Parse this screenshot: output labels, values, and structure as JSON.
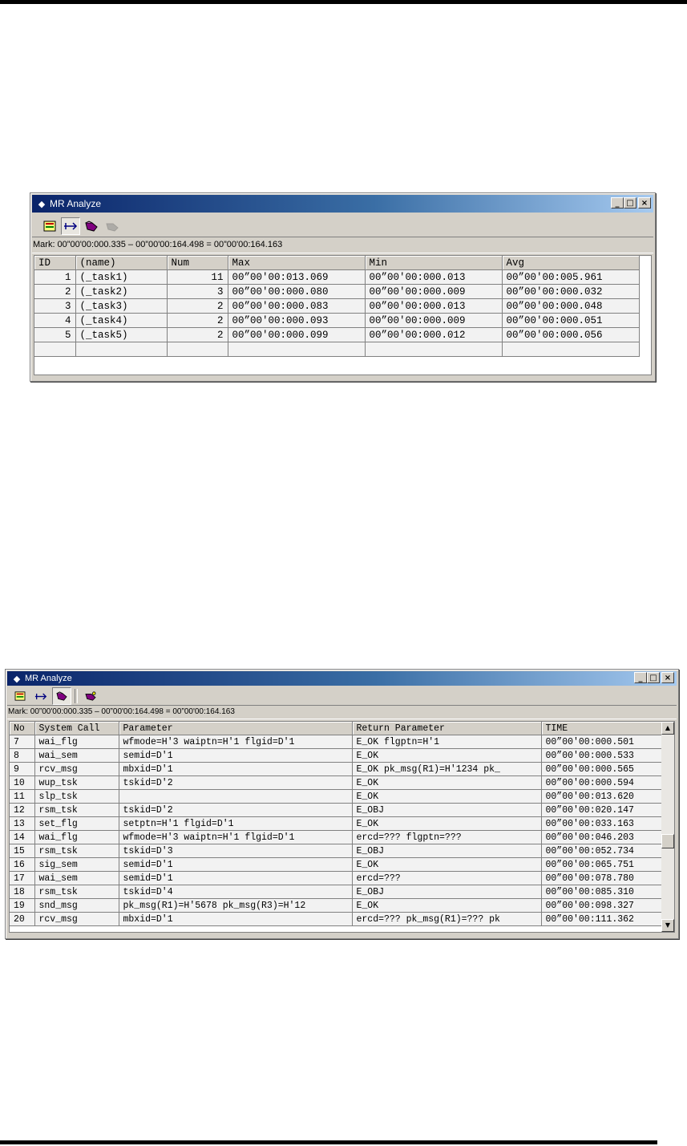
{
  "window1": {
    "title": "MR Analyze",
    "mark": "Mark: 00”00'00:000.335 – 00”00'00:164.498 = 00”00'00:164.163",
    "columns": [
      "ID",
      "(name)",
      "Num",
      "Max",
      "Min",
      "Avg"
    ],
    "rows": [
      {
        "id": "1",
        "name": "(_task1)",
        "num": "11",
        "max": "00”00'00:013.069",
        "min": "00”00'00:000.013",
        "avg": "00”00'00:005.961"
      },
      {
        "id": "2",
        "name": "(_task2)",
        "num": "3",
        "max": "00”00'00:000.080",
        "min": "00”00'00:000.009",
        "avg": "00”00'00:000.032"
      },
      {
        "id": "3",
        "name": "(_task3)",
        "num": "2",
        "max": "00”00'00:000.083",
        "min": "00”00'00:000.013",
        "avg": "00”00'00:000.048"
      },
      {
        "id": "4",
        "name": "(_task4)",
        "num": "2",
        "max": "00”00'00:000.093",
        "min": "00”00'00:000.009",
        "avg": "00”00'00:000.051"
      },
      {
        "id": "5",
        "name": "(_task5)",
        "num": "2",
        "max": "00”00'00:000.099",
        "min": "00”00'00:000.012",
        "avg": "00”00'00:000.056"
      }
    ]
  },
  "window2": {
    "title": "MR Analyze",
    "mark": "Mark: 00”00'00:000.335 – 00”00'00:164.498 = 00”00'00:164.163",
    "columns": [
      "No",
      "System Call",
      "Parameter",
      "Return Parameter",
      "TIME"
    ],
    "rows": [
      {
        "no": "7",
        "call": "wai_flg",
        "param": "wfmode=H'3   waiptn=H'1   flgid=D'1",
        "ret": "E_OK   flgptn=H'1",
        "time": "00”00'00:000.501"
      },
      {
        "no": "8",
        "call": "wai_sem",
        "param": "semid=D'1",
        "ret": "E_OK",
        "time": "00”00'00:000.533"
      },
      {
        "no": "9",
        "call": "rcv_msg",
        "param": "mbxid=D'1",
        "ret": "E_OK   pk_msg(R1)=H'1234   pk_",
        "time": "00”00'00:000.565"
      },
      {
        "no": "10",
        "call": "wup_tsk",
        "param": "tskid=D'2",
        "ret": "E_OK",
        "time": "00”00'00:000.594"
      },
      {
        "no": "11",
        "call": "slp_tsk",
        "param": "",
        "ret": "E_OK",
        "time": "00”00'00:013.620"
      },
      {
        "no": "12",
        "call": "rsm_tsk",
        "param": "tskid=D'2",
        "ret": "E_OBJ",
        "time": "00”00'00:020.147"
      },
      {
        "no": "13",
        "call": "set_flg",
        "param": "setptn=H'1   flgid=D'1",
        "ret": "E_OK",
        "time": "00”00'00:033.163"
      },
      {
        "no": "14",
        "call": "wai_flg",
        "param": "wfmode=H'3   waiptn=H'1   flgid=D'1",
        "ret": "ercd=???   flgptn=???",
        "time": "00”00'00:046.203"
      },
      {
        "no": "15",
        "call": "rsm_tsk",
        "param": "tskid=D'3",
        "ret": "E_OBJ",
        "time": "00”00'00:052.734"
      },
      {
        "no": "16",
        "call": "sig_sem",
        "param": "semid=D'1",
        "ret": "E_OK",
        "time": "00”00'00:065.751"
      },
      {
        "no": "17",
        "call": "wai_sem",
        "param": "semid=D'1",
        "ret": "ercd=???",
        "time": "00”00'00:078.780"
      },
      {
        "no": "18",
        "call": "rsm_tsk",
        "param": "tskid=D'4",
        "ret": "E_OBJ",
        "time": "00”00'00:085.310"
      },
      {
        "no": "19",
        "call": "snd_msg",
        "param": "pk_msg(R1)=H'5678   pk_msg(R3)=H'12",
        "ret": "E_OK",
        "time": "00”00'00:098.327"
      },
      {
        "no": "20",
        "call": "rcv_msg",
        "param": "mbxid=D'1",
        "ret": "ercd=???   pk_msg(R1)=???   pk",
        "time": "00”00'00:111.362"
      }
    ]
  }
}
